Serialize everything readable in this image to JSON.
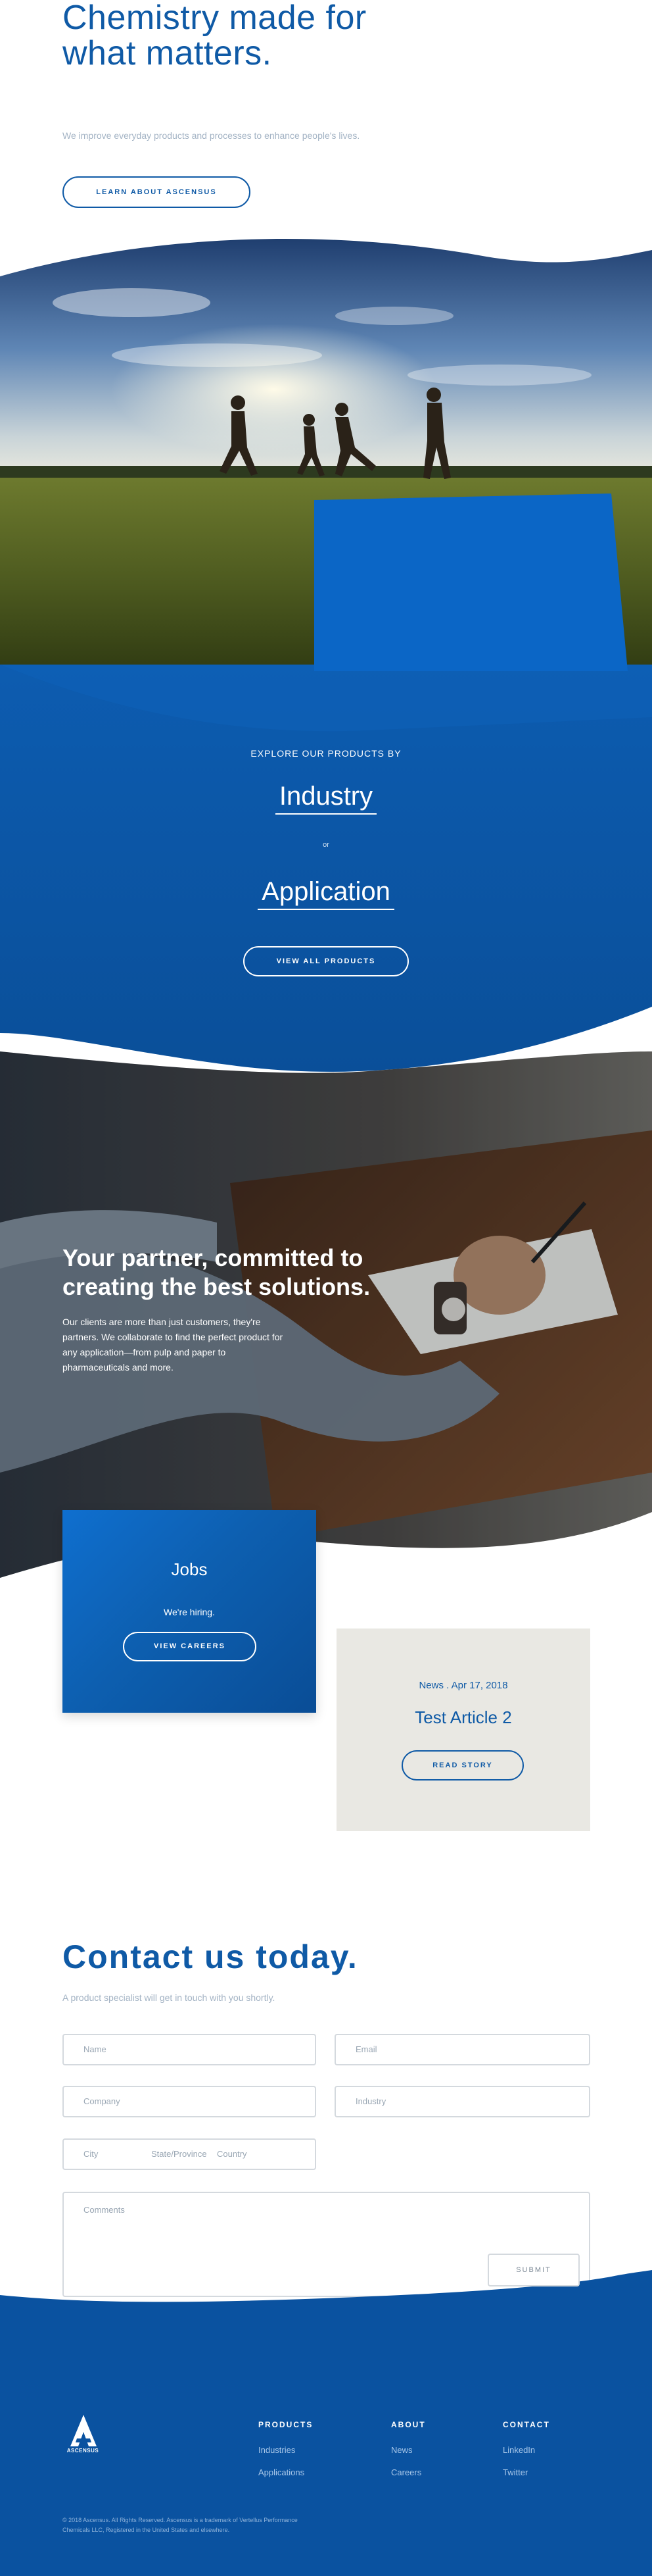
{
  "hero": {
    "title": "Chemistry made for what matters.",
    "subtitle": "We improve everyday products and processes to enhance people's lives.",
    "cta_label": "LEARN ABOUT ASCENSUS"
  },
  "products": {
    "label": "EXPLORE OUR PRODUCTS BY",
    "industry_label": "Industry",
    "or_label": "or",
    "application_label": "Application",
    "cta_label": "VIEW ALL PRODUCTS"
  },
  "partner": {
    "title": "Your partner, committed to creating the best solutions.",
    "body": "Our clients are more than just customers, they're partners. We collaborate to find the perfect product for any application—from pulp and paper to pharmaceuticals and more."
  },
  "jobs_card": {
    "title": "Jobs",
    "subtitle": "We're hiring.",
    "cta_label": "VIEW CAREERS"
  },
  "article_card": {
    "meta": "News . Apr 17, 2018",
    "title": "Test Article 2",
    "cta_label": "READ STORY"
  },
  "contact": {
    "title": "Contact us today.",
    "subtitle": "A product specialist will get in touch with you shortly.",
    "fields": {
      "name": "Name",
      "email": "Email",
      "company": "Company",
      "industry": "Industry",
      "city": "City",
      "state": "State/Province",
      "country": "Country",
      "comments": "Comments"
    },
    "submit_label": "SUBMIT"
  },
  "footer": {
    "logo_text": "ASCENSUS",
    "columns": [
      {
        "heading": "PRODUCTS",
        "links": [
          "Industries",
          "Applications"
        ]
      },
      {
        "heading": "ABOUT",
        "links": [
          "News",
          "Careers"
        ]
      },
      {
        "heading": "CONTACT",
        "links": [
          "LinkedIn",
          "Twitter"
        ]
      }
    ],
    "copyright": "© 2018 Ascensus. All Rights Reserved. Ascensus is a trademark of Vertellus Performance Chemicals LLC, Registered in the United States and elsewhere."
  },
  "colors": {
    "brand_blue": "#0f5aa6",
    "deep_blue": "#0a52a0",
    "card_beige": "#e9e8e3"
  }
}
